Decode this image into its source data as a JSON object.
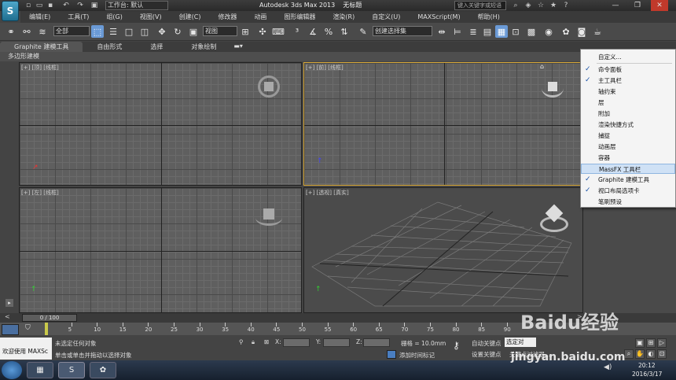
{
  "titlebar": {
    "logo_glyph": "S",
    "workspace": "工作台: 默认",
    "title": "Autodesk 3ds Max  2013",
    "untitled": "无标题",
    "search_placeholder": "键入关键字或短语"
  },
  "menu": [
    "编辑(E)",
    "工具(T)",
    "组(G)",
    "视图(V)",
    "创建(C)",
    "修改器",
    "动画",
    "图形编辑器",
    "渲染(R)",
    "自定义(U)",
    "MAXScript(M)",
    "帮助(H)"
  ],
  "toolbar": {
    "filter_all": "全部",
    "ref_coord": "视图",
    "named_sel": "创建选择集"
  },
  "ribbon": {
    "tabs": [
      "Graphite 建模工具",
      "自由形式",
      "选择",
      "对象绘制"
    ],
    "sub": "多边形建模"
  },
  "viewports": {
    "top": "[+] [顶] [线框]",
    "front": "[+] [前] [线框]",
    "left": "[+] [左] [线框]",
    "persp": "[+] [透视] [真实]"
  },
  "context_menu": [
    {
      "label": "自定义...",
      "checked": false
    },
    {
      "label": "命令面板",
      "checked": true
    },
    {
      "label": "主工具栏",
      "checked": true
    },
    {
      "label": "轴约束",
      "checked": false
    },
    {
      "label": "层",
      "checked": false
    },
    {
      "label": "附加",
      "checked": false
    },
    {
      "label": "渲染快捷方式",
      "checked": false
    },
    {
      "label": "捕捉",
      "checked": false
    },
    {
      "label": "动画层",
      "checked": false
    },
    {
      "label": "容器",
      "checked": false
    },
    {
      "label": "MassFX 工具栏",
      "checked": false,
      "highlight": true
    },
    {
      "label": "Graphite 建模工具",
      "checked": true
    },
    {
      "label": "视口布局选项卡",
      "checked": true
    },
    {
      "label": "笔刷预设",
      "checked": false
    }
  ],
  "timeline": {
    "slider_label": "0 / 100",
    "ticks": [
      "5",
      "10",
      "15",
      "20",
      "25",
      "30",
      "35",
      "40",
      "45",
      "50",
      "55",
      "60",
      "65",
      "70",
      "75",
      "80",
      "85",
      "90"
    ]
  },
  "status": {
    "welcome": "欢迎使用 MAXSc",
    "none_selected": "未选定任何对象",
    "prompt": "单击或单击并拖动以选择对象",
    "x_label": "X:",
    "y_label": "Y:",
    "z_label": "Z:",
    "grid": "栅格 = 10.0mm",
    "add_time_tag": "添加时间标记",
    "auto_key": "自动关键点",
    "set_key": "设置关键点",
    "selected_obj": "选定对",
    "key_filters": "关键点过滤器..."
  },
  "taskbar": {
    "time": "20:12",
    "date": "2016/3/17"
  },
  "watermark": {
    "brand": "Baidu经验",
    "url": "jingyan.baidu.com"
  }
}
